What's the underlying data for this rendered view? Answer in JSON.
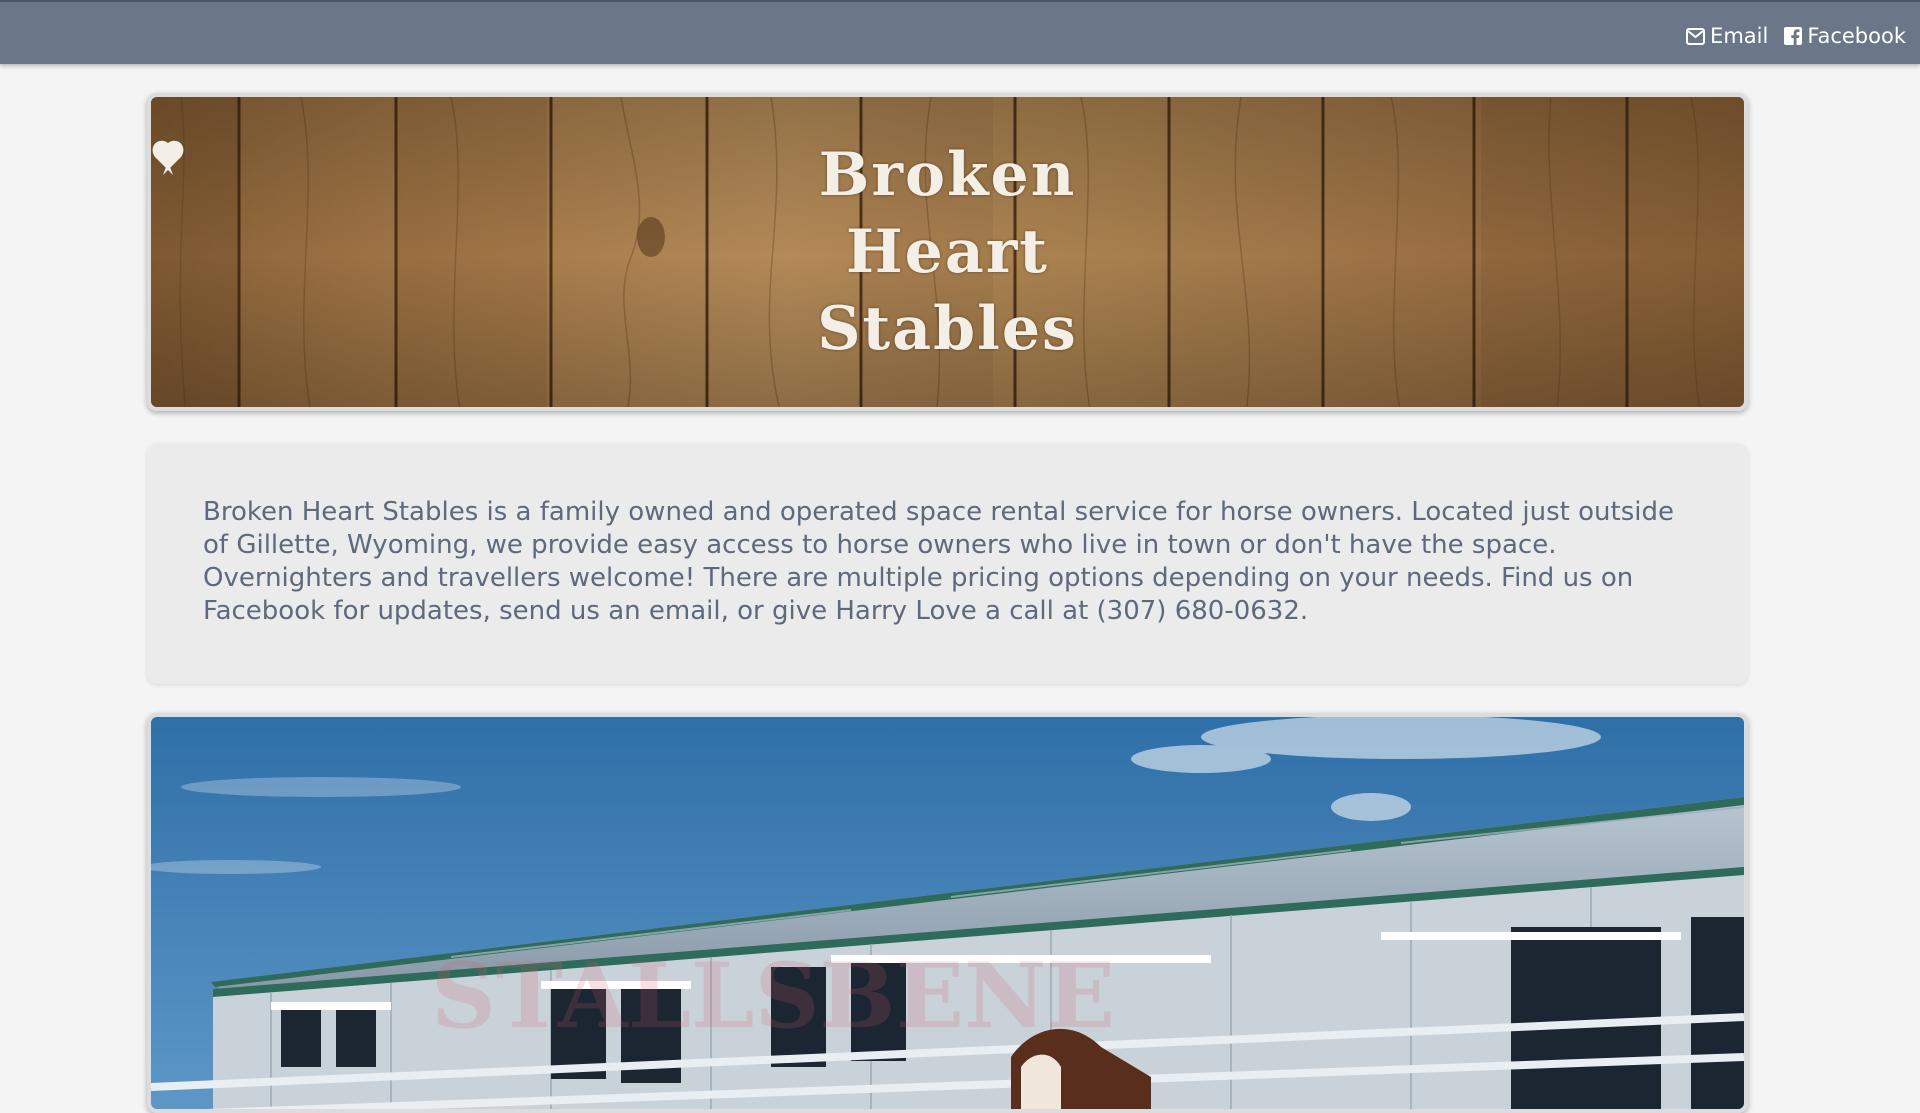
{
  "topbar": {
    "links": [
      {
        "label": "Email",
        "icon": "envelope-icon"
      },
      {
        "label": "Facebook",
        "icon": "facebook-icon"
      }
    ],
    "background": "#6b7789"
  },
  "banner": {
    "title_lines": [
      "Broken",
      "Heart",
      "Stables"
    ]
  },
  "info": {
    "text": "Broken Heart Stables is a family owned and operated space rental service for horse owners. Located just outside of Gillette, Wyoming, we provide easy access to horse owners who live in town or don't have the space. Overnighters and travellers welcome! There are multiple pricing options depending on your needs. Find us on Facebook for updates, send us an email, or give Harry Love a call at (307) 680-0632."
  },
  "photo": {
    "watermark": "STALLSBENE"
  },
  "colors": {
    "accent_text": "#5e6a7c",
    "page_background": "#f4f4f4"
  }
}
